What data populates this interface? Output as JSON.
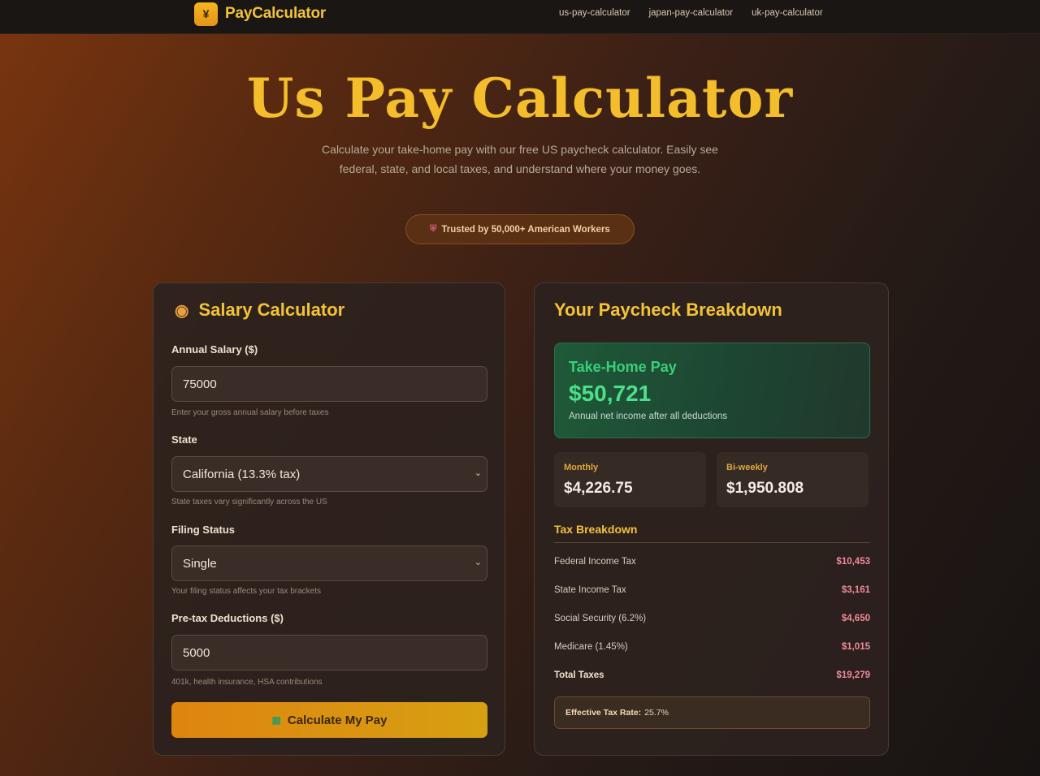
{
  "nav": {
    "brand_icon": "¥",
    "brand": "PayCalculator",
    "links": [
      "us-pay-calculator",
      "japan-pay-calculator",
      "uk-pay-calculator"
    ]
  },
  "hero": {
    "title": "Us Pay Calculator",
    "subtitle": "Calculate your take-home pay with our free US paycheck calculator. Easily see federal, state, and local taxes, and understand where your money goes.",
    "trust_badge": "Trusted by 50,000+ American Workers"
  },
  "calculator": {
    "title": "Salary Calculator",
    "annual_salary": {
      "label": "Annual Salary ($)",
      "value": "75000",
      "hint": "Enter your gross annual salary before taxes"
    },
    "state": {
      "label": "State",
      "value": "California (13.3% tax)",
      "hint": "State taxes vary significantly across the US"
    },
    "filing_status": {
      "label": "Filing Status",
      "value": "Single",
      "hint": "Your filing status affects your tax brackets"
    },
    "pretax": {
      "label": "Pre-tax Deductions ($)",
      "value": "5000",
      "hint": "401k, health insurance, HSA contributions"
    },
    "button": "Calculate My Pay"
  },
  "breakdown": {
    "title": "Your Paycheck Breakdown",
    "take_home": {
      "label": "Take-Home Pay",
      "value": "$50,721",
      "desc": "Annual net income after all deductions"
    },
    "monthly": {
      "label": "Monthly",
      "value": "$4,226.75"
    },
    "biweekly": {
      "label": "Bi-weekly",
      "value": "$1,950.808"
    },
    "tax_title": "Tax Breakdown",
    "taxes": [
      {
        "name": "Federal Income Tax",
        "value": "$10,453"
      },
      {
        "name": "State Income Tax",
        "value": "$3,161"
      },
      {
        "name": "Social Security (6.2%)",
        "value": "$4,650"
      },
      {
        "name": "Medicare (1.45%)",
        "value": "$1,015"
      },
      {
        "name": "Total Taxes",
        "value": "$19,279"
      }
    ],
    "effective_label": "Effective Tax Rate:",
    "effective_value": "25.7%"
  },
  "icons": {
    "brand": "yen-icon",
    "trust": "shield-icon",
    "calculator": "money-bag-icon",
    "button": "calculator-icon",
    "select": "chevron-down-icon"
  },
  "colors": {
    "accent": "#f3bd2c",
    "takehome_green": "#4ce08a",
    "tax_value": "#f08a9a",
    "button": "#de8410"
  }
}
